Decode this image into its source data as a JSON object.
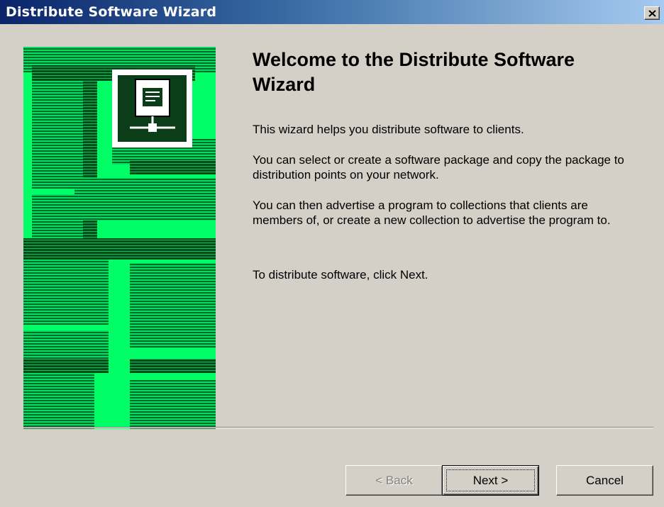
{
  "window": {
    "title": "Distribute Software Wizard",
    "close_label": "×"
  },
  "content": {
    "heading": "Welcome to the Distribute Software Wizard",
    "paragraphs": [
      "This wizard helps you distribute software to clients.",
      "You can select or create a software package and copy the package to distribution points on your network.",
      "You can then advertise a program to collections that clients are members of, or create a new collection to advertise the program to.",
      "To distribute software, click Next."
    ]
  },
  "buttons": {
    "back_label": "< Back",
    "next_label": "Next >",
    "cancel_label": "Cancel"
  },
  "colors": {
    "titlebar_start": "#0a246a",
    "titlebar_end": "#a6caf0",
    "art_green": "#00ff66",
    "dialog_bg": "#d4d0c8"
  },
  "icons": {
    "close": "close-icon",
    "wizard_art": "network-computer-illustration"
  }
}
